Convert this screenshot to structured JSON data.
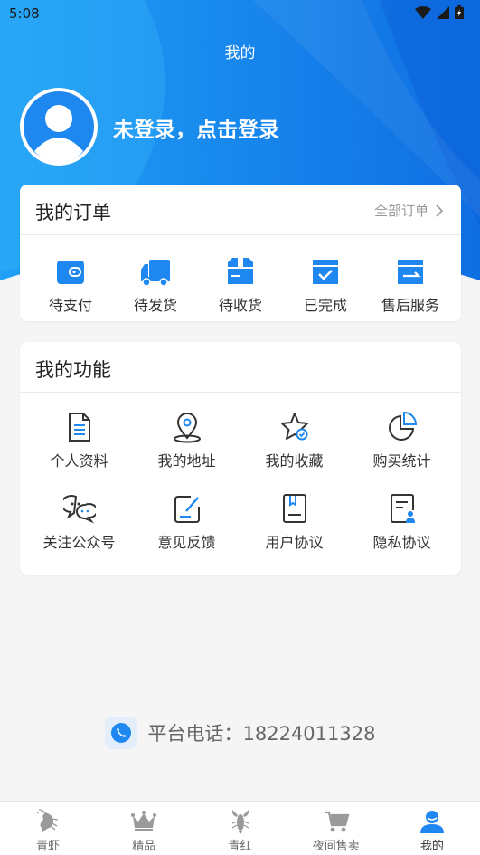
{
  "status_bar": {
    "time": "5:08"
  },
  "header": {
    "title": "我的",
    "login_prompt": "未登录，点击登录"
  },
  "orders": {
    "title": "我的订单",
    "all_orders": "全部订单",
    "items": [
      {
        "label": "待支付",
        "icon": "wallet-icon"
      },
      {
        "label": "待发货",
        "icon": "truck-icon"
      },
      {
        "label": "待收货",
        "icon": "package-icon"
      },
      {
        "label": "已完成",
        "icon": "box-check-icon"
      },
      {
        "label": "售后服务",
        "icon": "return-box-icon"
      }
    ]
  },
  "functions": {
    "title": "我的功能",
    "items": [
      {
        "label": "个人资料",
        "icon": "document-icon"
      },
      {
        "label": "我的地址",
        "icon": "location-pin-icon"
      },
      {
        "label": "我的收藏",
        "icon": "star-icon"
      },
      {
        "label": "购买统计",
        "icon": "pie-chart-icon"
      },
      {
        "label": "关注公众号",
        "icon": "wechat-icon"
      },
      {
        "label": "意见反馈",
        "icon": "feedback-icon"
      },
      {
        "label": "用户协议",
        "icon": "agreement-icon"
      },
      {
        "label": "隐私协议",
        "icon": "privacy-icon"
      }
    ]
  },
  "contact": {
    "phone_text": "平台电话：18224011328"
  },
  "tabbar": {
    "items": [
      {
        "label": "青虾",
        "icon": "shrimp-icon"
      },
      {
        "label": "精品",
        "icon": "crown-icon"
      },
      {
        "label": "青红",
        "icon": "crayfish-icon"
      },
      {
        "label": "夜间售卖",
        "icon": "cart-icon"
      },
      {
        "label": "我的",
        "icon": "user-icon",
        "active": true
      }
    ]
  },
  "colors": {
    "primary": "#1E88F0",
    "hero_dark": "#1070E0",
    "hero_light": "#2EA8F8"
  }
}
